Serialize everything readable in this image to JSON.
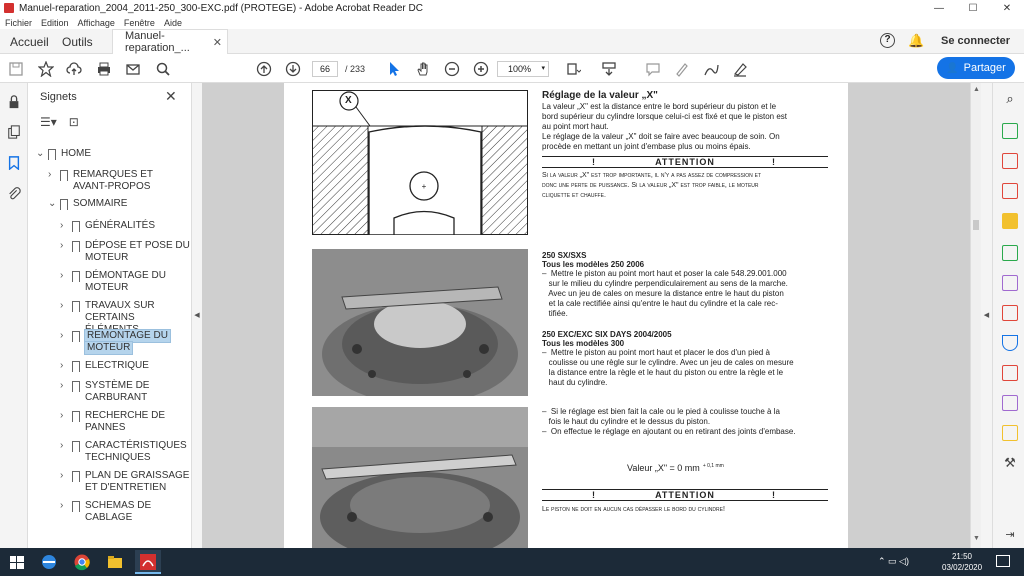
{
  "window": {
    "title": "Manuel-reparation_2004_2011-250_300-EXC.pdf (PROTEGE) - Adobe Acrobat Reader DC",
    "min": "—",
    "max": "☐",
    "close": "✕"
  },
  "menu": [
    "Fichier",
    "Edition",
    "Affichage",
    "Fenêtre",
    "Aide"
  ],
  "tabs": {
    "home": "Accueil",
    "tools": "Outils",
    "doc": "Manuel-reparation_...",
    "help": "?",
    "connect": "Se connecter"
  },
  "toolbar": {
    "page_current": "66",
    "page_total": "/ 233",
    "zoom": "100%",
    "share": "Partager"
  },
  "bookmarks": {
    "title": "Signets",
    "items": [
      {
        "label": "HOME"
      },
      {
        "label": "REMARQUES ET"
      },
      {
        "label": "AVANT-PROPOS"
      },
      {
        "label": "SOMMAIRE"
      },
      {
        "label": "GÉNÉRALITÉS"
      },
      {
        "label": "DÉPOSE ET POSE DU"
      },
      {
        "label": "MOTEUR"
      },
      {
        "label": "DÉMONTAGE DU"
      },
      {
        "label": "MOTEUR"
      },
      {
        "label": "TRAVAUX SUR"
      },
      {
        "label": "CERTAINS ÉLÉMENTS"
      },
      {
        "label": "REMONTAGE DU"
      },
      {
        "label": "MOTEUR"
      },
      {
        "label": "ELECTRIQUE"
      },
      {
        "label": "SYSTÈME DE"
      },
      {
        "label": "CARBURANT"
      },
      {
        "label": "RECHERCHE DE"
      },
      {
        "label": "PANNES"
      },
      {
        "label": "CARACTÉRISTIQUES"
      },
      {
        "label": "TECHNIQUES"
      },
      {
        "label": "PLAN DE GRAISSAGE"
      },
      {
        "label": "ET D'ENTRETIEN"
      },
      {
        "label": "SCHEMAS DE"
      },
      {
        "label": "CABLAGE"
      }
    ]
  },
  "pdf": {
    "x_label": "X",
    "heading": "Réglage de la valeur „X\"",
    "p1": [
      "La valeur „X\" est la distance entre le bord supérieur du piston et le",
      "bord supérieur du cylindre lorsque celui-ci est fixé et que le piston est",
      "au point mort haut.",
      "Le réglage de la valeur „X\" doit se faire avec beaucoup de soin. On",
      "procède en mettant un joint d'embase plus ou moins épais."
    ],
    "attention": "ATTENTION",
    "bang": "!",
    "warn1": [
      "Si la valeur „X\" est trop importante, il n'y a pas assez de compression et",
      "donc une perte de puissance. Si la valeur „X\" est trop faible, le moteur",
      "cliquette et chauffe."
    ],
    "s1_title": "250 SX/SXS",
    "s1_sub": "Tous les modèles 250 2006",
    "s1_body": [
      "–  Mettre le piston au point mort haut et poser la cale 548.29.001.000",
      "   sur le milieu du cylindre perpendiculairement au sens de la marche.",
      "   Avec un jeu de cales on mesure la distance entre le haut du piston",
      "   et la cale rectifiée ainsi qu'entre le haut du cylindre et la cale rec-",
      "   tifiée."
    ],
    "s2_title": "250 EXC/EXC SIX DAYS 2004/2005",
    "s2_sub": "Tous les modèles 300",
    "s2_body": [
      "–  Mettre le piston au point mort haut et placer le dos d'un pied à",
      "   coulisse ou une règle sur le cylindre. Avec un jeu de cales on mesure",
      "   la distance entre la règle et le haut du piston ou entre la règle et le",
      "   haut du cylindre."
    ],
    "s3_body": [
      "–  Si le réglage est bien fait la cale ou le pied à coulisse touche à la",
      "   fois le haut du cylindre et le dessus du piston.",
      "–  On effectue le réglage en ajoutant ou en retirant des joints d'embase."
    ],
    "formula": "Valeur „X\" = 0 mm",
    "formula_sup": "+ 0,1 mm",
    "warn2": "Le piston ne doit en aucun cas dépasser le bord du cylindre!"
  },
  "clock": {
    "time": "21:50",
    "date": "03/02/2020"
  },
  "colors": {
    "accent": "#1473e6",
    "selection": "#b5d4ec",
    "taskbar": "#1c2a38"
  }
}
